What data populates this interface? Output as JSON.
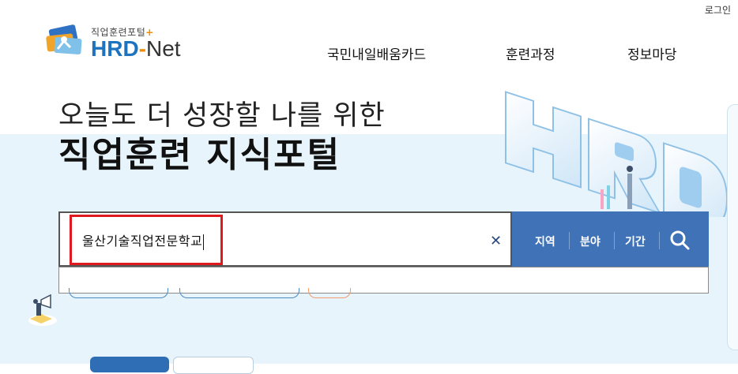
{
  "header": {
    "login_label": "로그인",
    "logo": {
      "subtitle": "직업훈련포털",
      "plus": "+",
      "hrd": "HRD",
      "dash": "-",
      "net": "Net"
    },
    "nav": [
      {
        "label": "국민내일배움카드"
      },
      {
        "label": "훈련과정"
      },
      {
        "label": "정보마당"
      }
    ]
  },
  "hero": {
    "line1": "오늘도 더 성장할 나를 위한",
    "line2": "직업훈련 지식포털"
  },
  "search": {
    "value": "울산기술직업전문학교",
    "clear_icon": "close-icon",
    "filters": [
      {
        "label": "지역"
      },
      {
        "label": "분야"
      },
      {
        "label": "기간"
      }
    ],
    "submit_icon": "search-icon"
  },
  "colors": {
    "brand_blue": "#3f72b7",
    "highlight_red": "#e0191f",
    "hero_bg": "#e7f4fb"
  }
}
